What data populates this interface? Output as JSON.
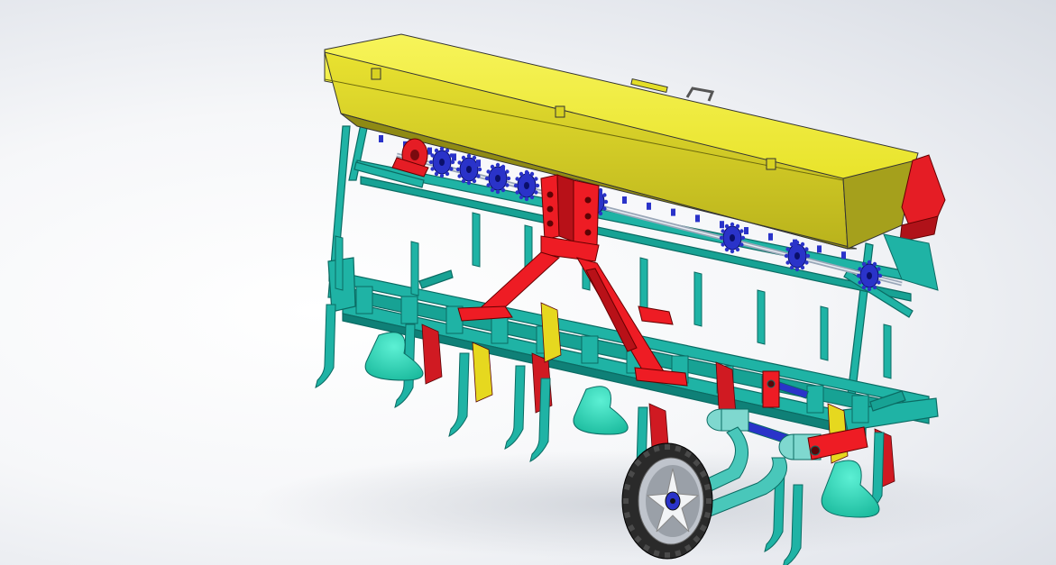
{
  "scene": {
    "subject": "seed-drill-cad-model",
    "colors": {
      "hopper": "#f4f03a",
      "hopper_shade": "#a9a21a",
      "frame": "#1fb3a5",
      "frame_dark": "#0f8077",
      "hitch": "#ee1c24",
      "shoe": "#30e3c4",
      "sprocket": "#2a33c9",
      "furrow_red": "#d01a22",
      "furrow_yellow": "#e6d81f",
      "tire": "#2a2a2a"
    }
  }
}
